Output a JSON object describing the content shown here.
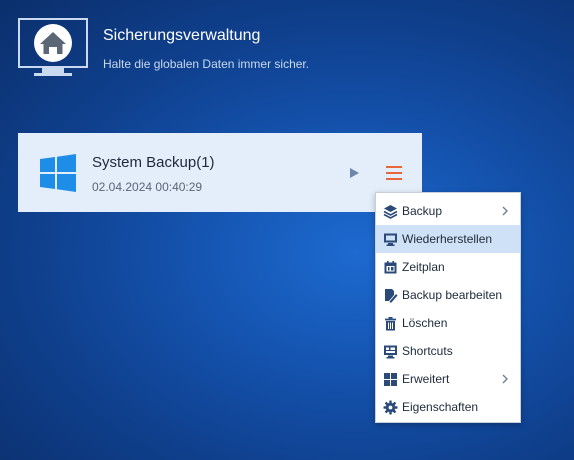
{
  "header": {
    "title": "Sicherungsverwaltung",
    "subtitle": "Halte die globalen Daten immer sicher.",
    "icon": "monitor-home-icon"
  },
  "backup_card": {
    "name": "System Backup(1)",
    "date": "02.04.2024 00:40:29",
    "icon": "windows-logo-icon"
  },
  "context_menu": {
    "items": [
      {
        "label": "Backup",
        "icon": "layers-icon",
        "submenu": true
      },
      {
        "label": "Wiederherstellen",
        "icon": "restore-monitor-icon",
        "highlighted": true
      },
      {
        "label": "Zeitplan",
        "icon": "calendar-icon"
      },
      {
        "label": "Backup bearbeiten",
        "icon": "edit-file-icon"
      },
      {
        "label": "Löschen",
        "icon": "trash-icon"
      },
      {
        "label": "Shortcuts",
        "icon": "shortcuts-icon"
      },
      {
        "label": "Erweitert",
        "icon": "grid-icon",
        "submenu": true
      },
      {
        "label": "Eigenschaften",
        "icon": "gear-icon"
      }
    ]
  },
  "colors": {
    "background": "#1452ad",
    "card": "#e4eefb",
    "accent_orange": "#e8663a",
    "icon_blue": "#2b4a7a",
    "menu_highlight": "#cfe1f7"
  }
}
